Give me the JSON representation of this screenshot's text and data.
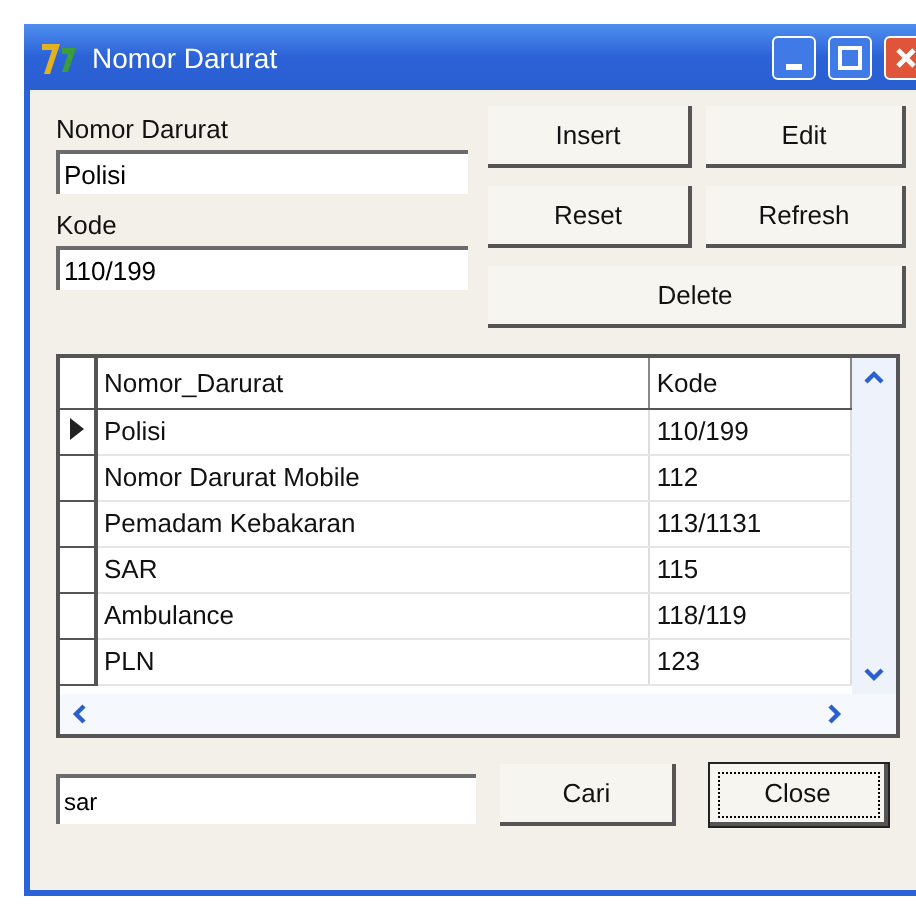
{
  "window": {
    "title": "Nomor Darurat"
  },
  "form": {
    "fields": [
      {
        "label": "Nomor Darurat",
        "value": "Polisi"
      },
      {
        "label": "Kode",
        "value": "110/199"
      }
    ],
    "buttons": [
      {
        "label": "Insert",
        "wide": false
      },
      {
        "label": "Edit",
        "wide": false
      },
      {
        "label": "Reset",
        "wide": false
      },
      {
        "label": "Refresh",
        "wide": false
      },
      {
        "label": "Delete",
        "wide": true
      }
    ]
  },
  "table": {
    "columns": [
      "Nomor_Darurat",
      "Kode"
    ],
    "rows": [
      {
        "cells": [
          "Polisi",
          "110/199"
        ],
        "selected": true
      },
      {
        "cells": [
          "Nomor Darurat Mobile",
          "112"
        ],
        "selected": false
      },
      {
        "cells": [
          "Pemadam Kebakaran",
          "113/1131"
        ],
        "selected": false
      },
      {
        "cells": [
          "SAR",
          "115"
        ],
        "selected": false
      },
      {
        "cells": [
          "Ambulance",
          "118/119"
        ],
        "selected": false
      },
      {
        "cells": [
          "PLN",
          "123"
        ],
        "selected": false
      }
    ]
  },
  "search": {
    "value": "sar"
  },
  "bottom_buttons": [
    {
      "label": "Cari",
      "focused": false
    },
    {
      "label": "Close",
      "focused": true
    }
  ]
}
